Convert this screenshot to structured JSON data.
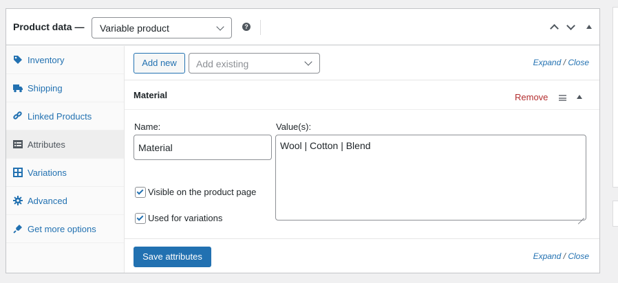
{
  "header": {
    "title": "Product data —",
    "product_type": "Variable product",
    "help_glyph": "?"
  },
  "tabs": [
    {
      "label": "Inventory",
      "icon": "tag-icon"
    },
    {
      "label": "Shipping",
      "icon": "truck-icon"
    },
    {
      "label": "Linked Products",
      "icon": "link-icon"
    },
    {
      "label": "Attributes",
      "icon": "list-icon",
      "active": true
    },
    {
      "label": "Variations",
      "icon": "grid-icon"
    },
    {
      "label": "Advanced",
      "icon": "gear-icon"
    },
    {
      "label": "Get more options",
      "icon": "plugin-icon"
    }
  ],
  "toolbar": {
    "add_new": "Add new",
    "add_existing_placeholder": "Add existing",
    "expand": "Expand",
    "separator": "/",
    "close": "Close"
  },
  "attribute": {
    "name": "Material",
    "remove": "Remove",
    "name_label": "Name:",
    "name_value": "Material",
    "values_label": "Value(s):",
    "values_value": "Wool | Cotton | Blend",
    "visible_label": "Visible on the product page",
    "visible_checked": true,
    "variations_label": "Used for variations",
    "variations_checked": true
  },
  "footer": {
    "save": "Save attributes",
    "expand": "Expand",
    "separator": "/",
    "close": "Close"
  },
  "colors": {
    "link": "#2271b1",
    "remove": "#b32d2e",
    "primary_button": "#2271b1"
  }
}
